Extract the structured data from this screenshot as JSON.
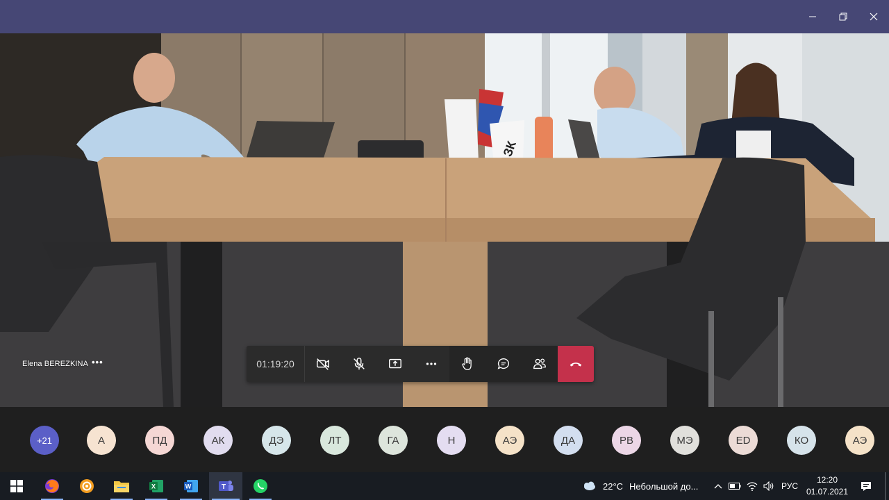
{
  "window": {
    "controls": {
      "minimize": "minimize",
      "maximize": "restore",
      "close": "close"
    }
  },
  "video": {
    "speaker_name": "Elena BEREZKINA",
    "speaker_menu": "•••",
    "flag_text": "РАЗК"
  },
  "call_controls": {
    "timer": "01:19:20",
    "buttons": [
      "camera-off-icon",
      "mic-off-icon",
      "share-screen-icon",
      "more-icon",
      "raise-hand-icon",
      "chat-icon",
      "participants-icon",
      "hangup-icon"
    ]
  },
  "participants": {
    "overflow": "+21",
    "avatars": [
      {
        "initials": "А",
        "color": "#f6e3d1"
      },
      {
        "initials": "ПД",
        "color": "#f5d7d4"
      },
      {
        "initials": "АК",
        "color": "#e1dcef"
      },
      {
        "initials": "ДЭ",
        "color": "#d6e6ea"
      },
      {
        "initials": "ЛТ",
        "color": "#d9e8dd"
      },
      {
        "initials": "ГА",
        "color": "#dde5dc"
      },
      {
        "initials": "Н",
        "color": "#e4ddf1"
      },
      {
        "initials": "АЭ",
        "color": "#f5e2c8"
      },
      {
        "initials": "ДА",
        "color": "#d3deef"
      },
      {
        "initials": "РВ",
        "color": "#ecd6e6"
      },
      {
        "initials": "МЭ",
        "color": "#e1e0dc"
      },
      {
        "initials": "ED",
        "color": "#ecdbd6"
      },
      {
        "initials": "КО",
        "color": "#d6e3ea"
      },
      {
        "initials": "АЭ",
        "color": "#f5e2c8"
      }
    ]
  },
  "taskbar": {
    "apps": [
      "windows-start-icon",
      "firefox-icon",
      "settings-app-icon",
      "file-explorer-icon",
      "excel-icon",
      "word-icon",
      "teams-icon",
      "whatsapp-icon"
    ],
    "weather": {
      "temp": "22°C",
      "desc": "Небольшой до..."
    },
    "language": "РУС",
    "time": "12:20",
    "date": "01.07.2021"
  }
}
